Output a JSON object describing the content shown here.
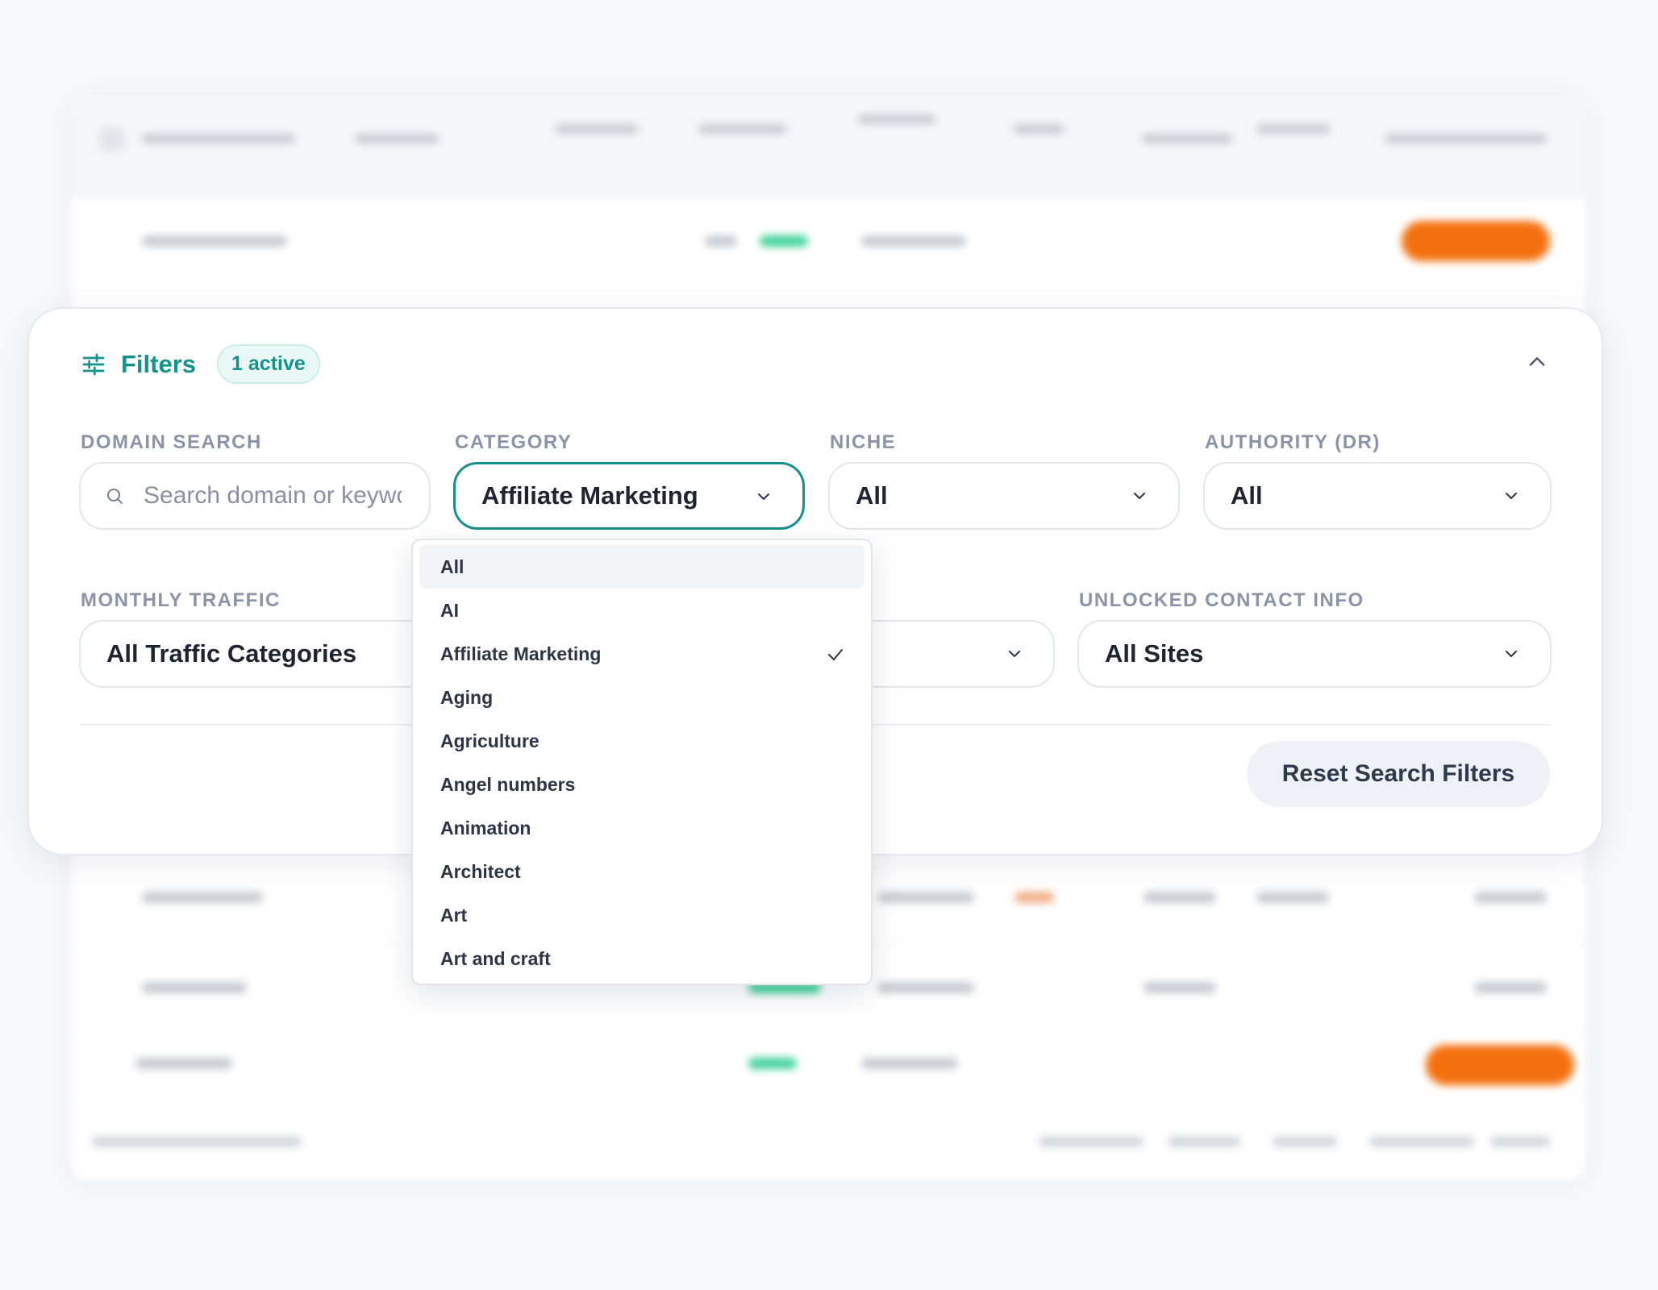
{
  "filters": {
    "title": "Filters",
    "active_badge": "1 active"
  },
  "fields": {
    "domain_search": {
      "label": "DOMAIN SEARCH",
      "placeholder": "Search domain or keyword"
    },
    "category": {
      "label": "CATEGORY",
      "value": "Affiliate Marketing"
    },
    "niche": {
      "label": "NICHE",
      "value": "All"
    },
    "authority": {
      "label": "AUTHORITY (DR)",
      "value": "All"
    },
    "monthly_traffic": {
      "label": "MONTHLY TRAFFIC",
      "value": "All Traffic Categories"
    },
    "unlocked_contact": {
      "label": "UNLOCKED CONTACT INFO",
      "value": "All Sites"
    }
  },
  "reset_button": "Reset Search Filters",
  "category_dropdown": {
    "options": [
      "All",
      "AI",
      "Affiliate Marketing",
      "Aging",
      "Agriculture",
      "Angel numbers",
      "Animation",
      "Architect",
      "Art",
      "Art and craft"
    ],
    "selected": "Affiliate Marketing",
    "highlighted": "All"
  },
  "colors": {
    "accent": "#15928a",
    "focus_border": "#16908a",
    "badge_bg": "#e9f8f4",
    "label": "#8b93a6",
    "orange_pill": "#f4700f"
  },
  "icons": {
    "filters": "sliders-icon",
    "collapse": "chevron-up-icon",
    "search": "search-icon",
    "dropdown": "chevron-down-icon",
    "selected": "check-icon"
  }
}
